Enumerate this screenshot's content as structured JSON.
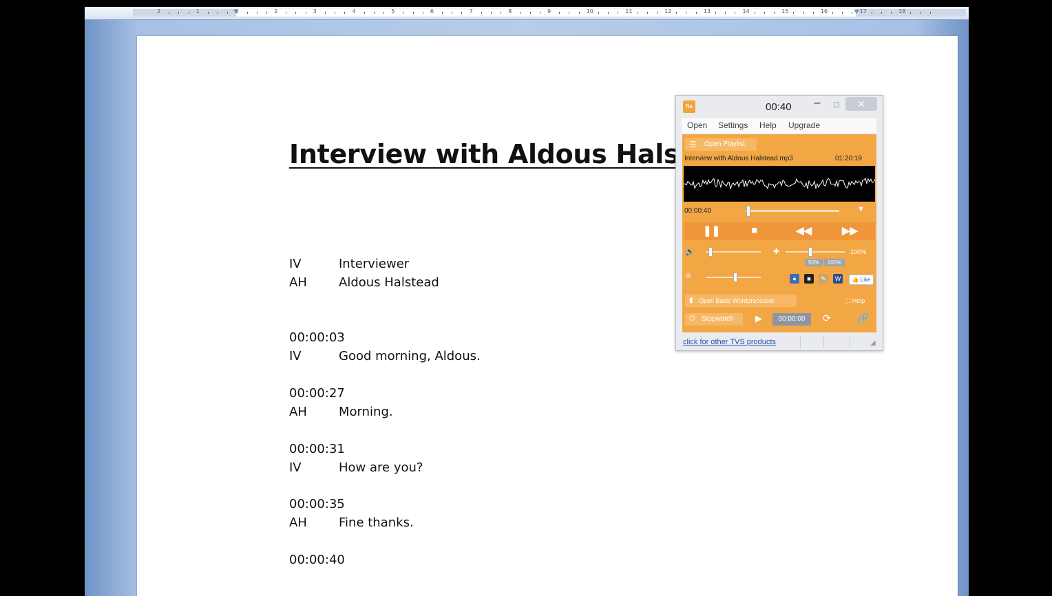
{
  "ruler": {
    "numbers": [
      "2",
      "1",
      "1",
      "2",
      "3",
      "4",
      "5",
      "6",
      "7",
      "8",
      "9",
      "10",
      "11",
      "12",
      "13",
      "14",
      "15",
      "16",
      "17",
      "18"
    ]
  },
  "document": {
    "title": "Interview with Aldous Halstead",
    "lines": [
      {
        "a": "IV",
        "b": "Interviewer"
      },
      {
        "a": "AH",
        "b": "Aldous Halstead"
      },
      {
        "a": "00:00:03",
        "b": ""
      },
      {
        "a": "IV",
        "b": "Good morning, Aldous."
      },
      {
        "a": "00:00:27",
        "b": ""
      },
      {
        "a": "AH",
        "b": "Morning."
      },
      {
        "a": "00:00:31",
        "b": ""
      },
      {
        "a": "IV",
        "b": "How are you?"
      },
      {
        "a": "00:00:35",
        "b": ""
      },
      {
        "a": "AH",
        "b": "Fine thanks."
      },
      {
        "a": "00:00:40",
        "b": ""
      }
    ]
  },
  "player": {
    "logo_text": "fts",
    "title_time": "00:40",
    "minimize_label": "–",
    "maximize_label": "□",
    "close_label": "✕",
    "menu": [
      "Open",
      "Settings",
      "Help",
      "Upgrade"
    ],
    "playlist_button": "Open Playlist",
    "file_name": "Interview with Aldous Halstead.mp3",
    "duration": "01:20:19",
    "position": "00:00:40",
    "playback_fraction": 0.008,
    "volume_fraction": 0.05,
    "speed_percent": "100%",
    "presets": [
      "50%",
      "100%"
    ],
    "tone_fraction": 0.5,
    "apps": [
      {
        "name": "app-blue",
        "glyph": "●",
        "color": "#3a6fb8"
      },
      {
        "name": "app-black",
        "glyph": "■",
        "color": "#222222"
      },
      {
        "name": "app-notepad",
        "glyph": "✎",
        "color": "#c8a46a"
      },
      {
        "name": "app-word",
        "glyph": "W",
        "color": "#2b4f8c"
      }
    ],
    "like_label": "👍 Like",
    "wordprocessor_button": "Open Basic Wordprocessor",
    "help_label": "⛶ Help",
    "stopwatch_button": "Stopwatch",
    "stopwatch_time": "00:00:00",
    "footer_link": "click for other TVS products",
    "colors": {
      "accent": "#f2a744",
      "transport": "#f0963a"
    }
  }
}
